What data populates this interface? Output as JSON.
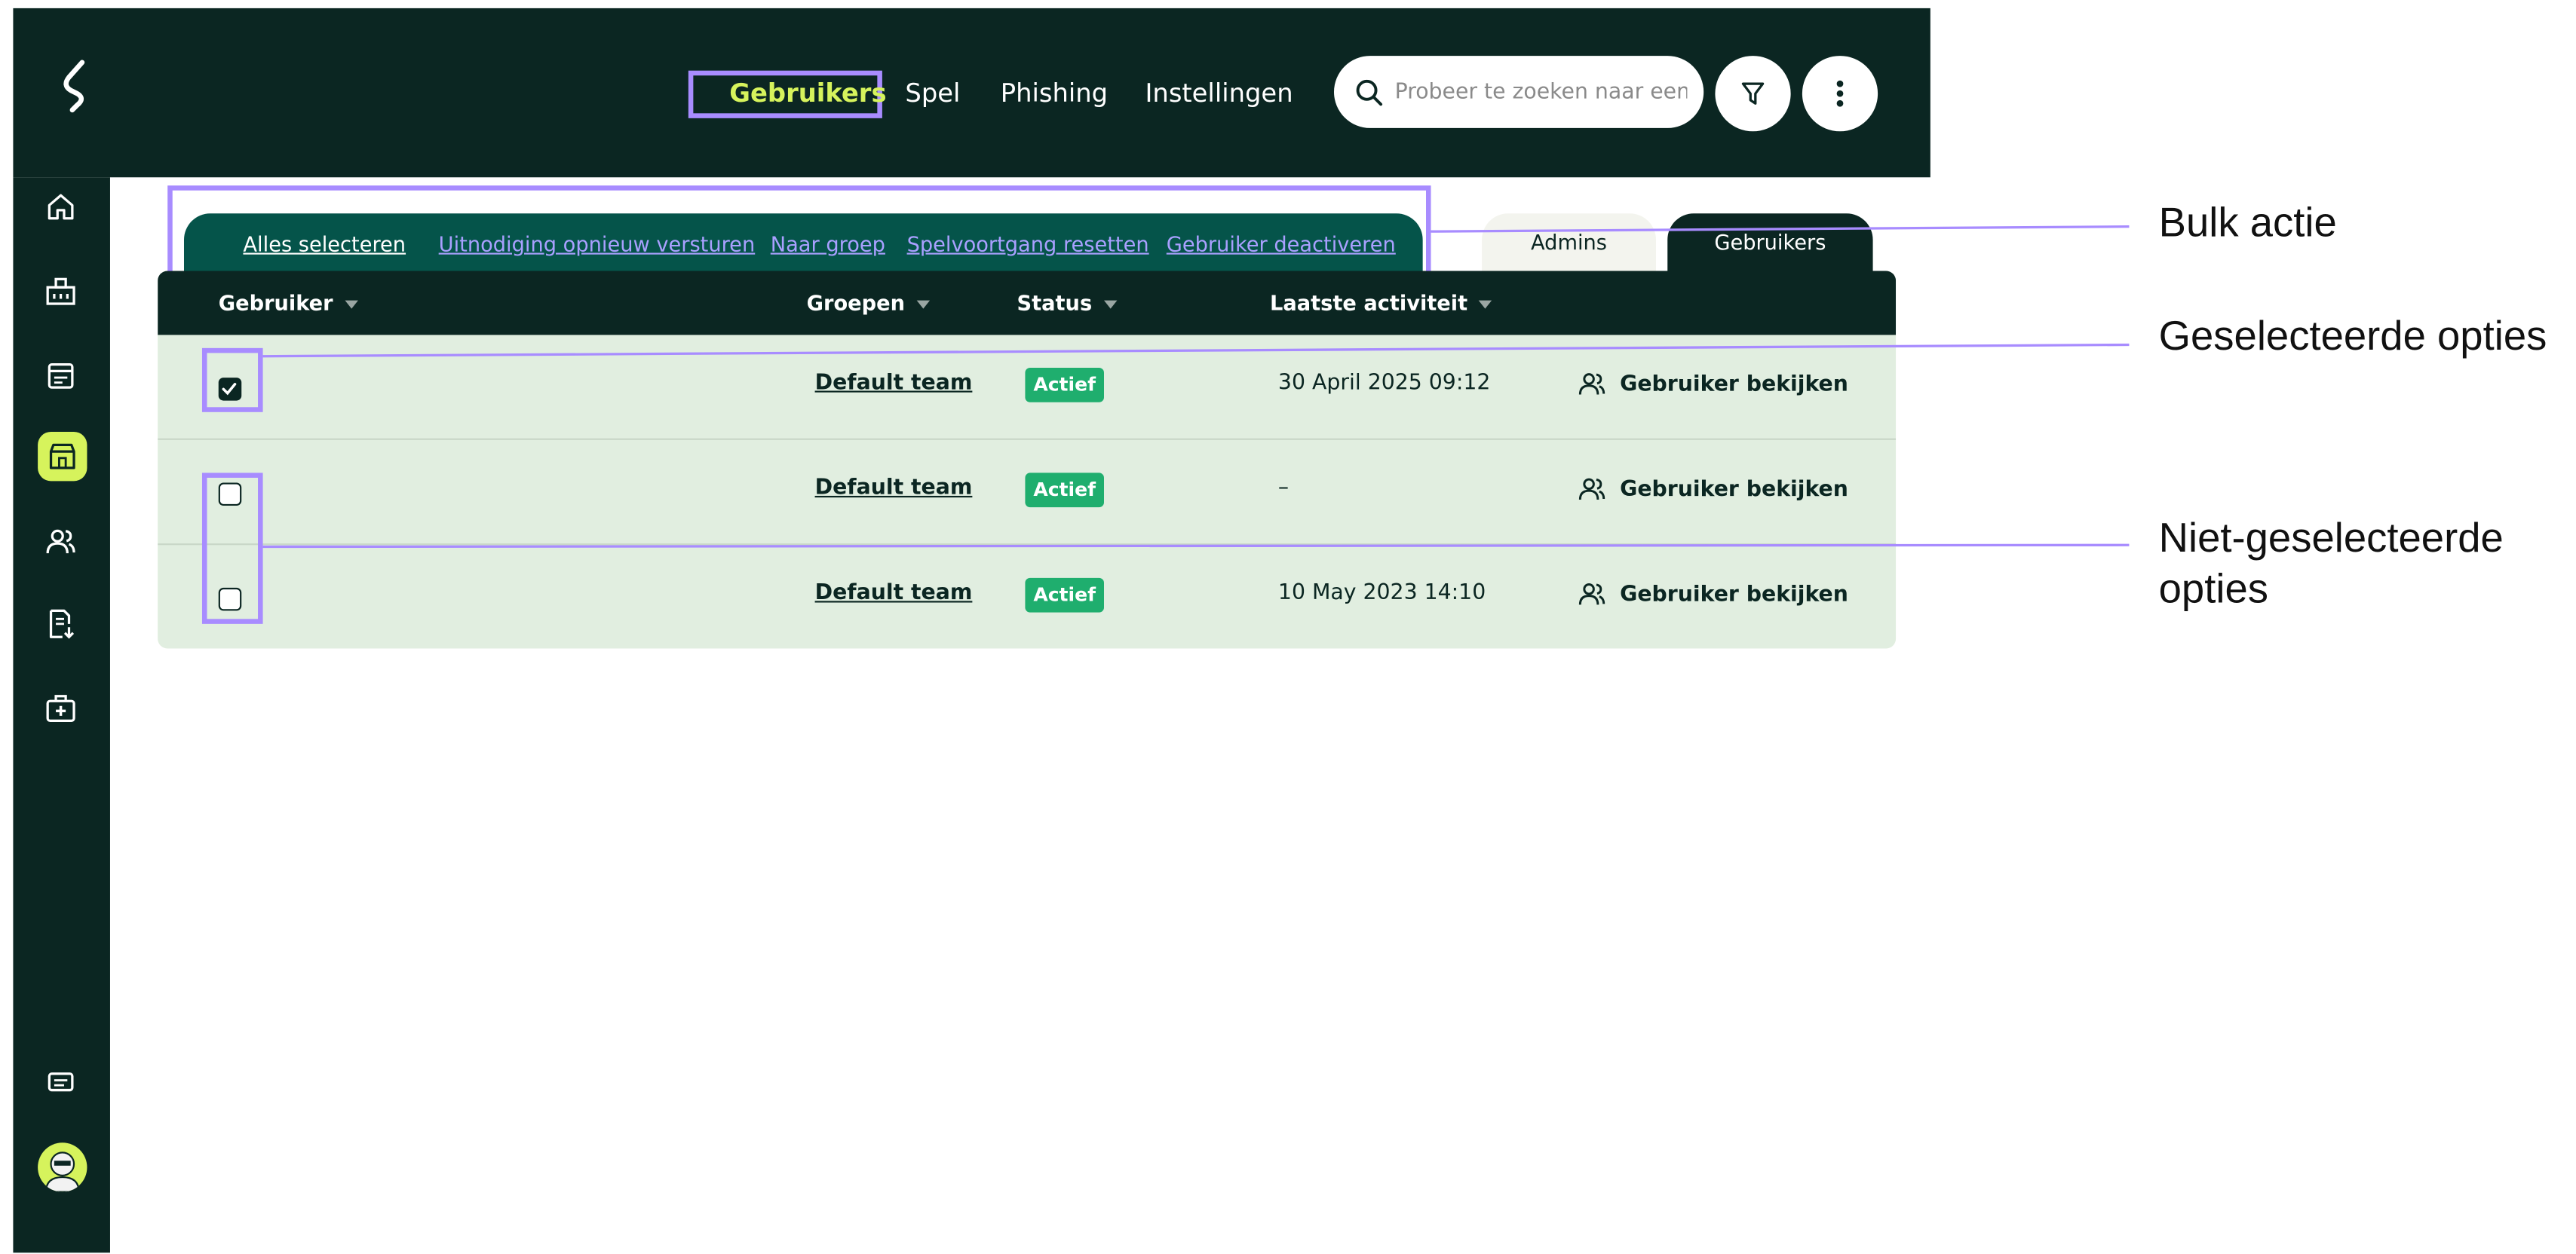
{
  "nav": {
    "items": [
      {
        "label": "Gebruikers",
        "active": true
      },
      {
        "label": "Spel",
        "active": false
      },
      {
        "label": "Phishing",
        "active": false
      },
      {
        "label": "Instellingen",
        "active": false
      }
    ]
  },
  "search": {
    "placeholder": "Probeer te zoeken naar een r"
  },
  "sidebar": {
    "icons": [
      "home-icon",
      "building-icon",
      "calendar-icon",
      "store-icon",
      "users-icon",
      "report-icon",
      "first-aid-kit-icon",
      "chat-icon"
    ],
    "active_icon": "store-icon"
  },
  "bulk_actions": {
    "items": [
      "Alles selecteren",
      "Uitnodiging opnieuw versturen",
      "Naar groep",
      "Spelvoortgang resetten",
      "Gebruiker deactiveren"
    ]
  },
  "tabs": {
    "admins": "Admins",
    "users": "Gebruikers"
  },
  "table": {
    "columns": [
      "Gebruiker",
      "Groepen",
      "Status",
      "Laatste activiteit"
    ],
    "rows": [
      {
        "selected": true,
        "group": "Default team",
        "status": "Actief",
        "last_activity": "30 April 2025 09:12",
        "action": "Gebruiker bekijken"
      },
      {
        "selected": false,
        "group": "Default team",
        "status": "Actief",
        "last_activity": "–",
        "action": "Gebruiker bekijken"
      },
      {
        "selected": false,
        "group": "Default team",
        "status": "Actief",
        "last_activity": "10 May 2023 14:10",
        "action": "Gebruiker bekijken"
      }
    ]
  },
  "annotations": {
    "bulk": "Bulk actie",
    "selected": "Geselecteerde opties",
    "unselected_line1": "Niet-geselecteerde",
    "unselected_line2": "opties"
  },
  "colors": {
    "dark": "#0b2622",
    "accent": "#d6f35c",
    "highlight": "#a88cff",
    "badge": "#1fae6e",
    "table_bg": "#e1eee0"
  }
}
